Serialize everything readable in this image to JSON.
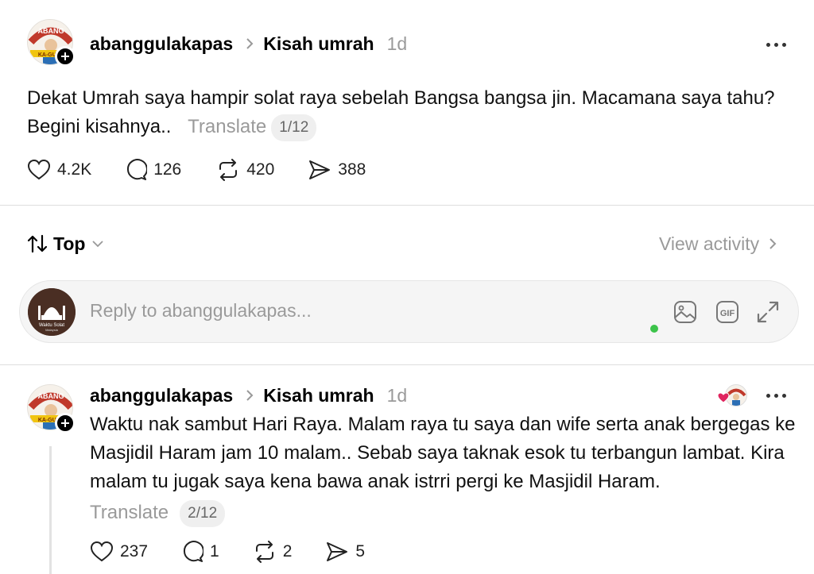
{
  "post": {
    "avatar_text_top": "ABANG",
    "avatar_text_bottom": "KA-GULA",
    "username": "abanggulakapas",
    "topic": "Kisah umrah",
    "time": "1d",
    "text": "Dekat Umrah saya hampir solat raya sebelah Bangsa bangsa jin. Macamana saya tahu? Begini kisahnya..",
    "translate_label": "Translate",
    "page_indicator": "1/12",
    "likes": "4.2K",
    "comments": "126",
    "reposts": "420",
    "shares": "388"
  },
  "sort": {
    "label": "Top",
    "view_activity": "View activity"
  },
  "reply": {
    "placeholder": "Reply to abanggulakapas...",
    "avatar_line1": "Waktu Solat",
    "avatar_line2": "Malaysia",
    "gif_label": "GIF"
  },
  "thread_post": {
    "username": "abanggulakapas",
    "topic": "Kisah umrah",
    "time": "1d",
    "text": "Waktu nak sambut Hari Raya. Malam raya tu saya dan wife serta anak bergegas ke Masjidil Haram jam 10 malam.. Sebab saya taknak esok tu terbangun lambat. Kira malam tu jugak saya kena bawa anak istrri pergi ke Masjidil Haram.",
    "translate_label": "Translate",
    "page_indicator": "2/12",
    "likes": "237",
    "comments": "1",
    "reposts": "2",
    "shares": "5"
  },
  "colors": {
    "muted": "#9a9a9a",
    "online": "#3cc34a",
    "heart": "#e0245e"
  }
}
